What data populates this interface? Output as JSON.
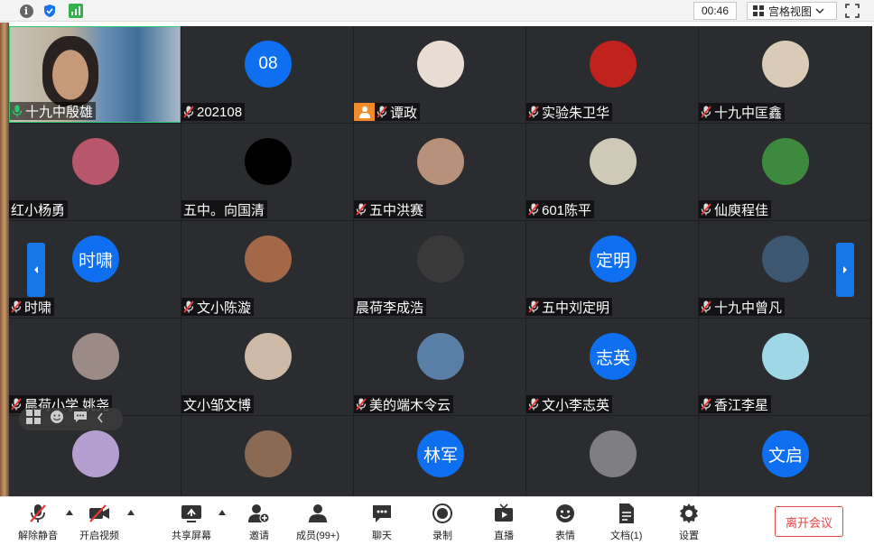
{
  "topbar": {
    "timer": "00:46",
    "view_label": "宫格视图",
    "icons": [
      "info-icon",
      "shield-icon",
      "signal-icon",
      "grid-view-icon",
      "chevron-down-icon",
      "fullscreen-icon"
    ]
  },
  "participants": [
    {
      "name": "十九中殷雄",
      "avatar_text": "",
      "avatar_color": "#7a6e62",
      "mic": "on",
      "video": true
    },
    {
      "name": "202108",
      "avatar_text": "08",
      "avatar_color": "#0e6ff0",
      "mic": "muted"
    },
    {
      "name": "谭政",
      "avatar_text": "",
      "avatar_color": "#e9dcd3",
      "mic": "muted",
      "badge": "user-icon"
    },
    {
      "name": "实验朱卫华",
      "avatar_text": "",
      "avatar_color": "#c0231d",
      "mic": "muted"
    },
    {
      "name": "十九中匡鑫",
      "avatar_text": "",
      "avatar_color": "#d9cbb6",
      "mic": "muted"
    },
    {
      "name": "红小杨勇",
      "avatar_text": "",
      "avatar_color": "#b8576c",
      "mic": "none"
    },
    {
      "name": "五中。向国清",
      "avatar_text": "",
      "avatar_color": "#000000",
      "mic": "none"
    },
    {
      "name": "五中洪赛",
      "avatar_text": "",
      "avatar_color": "#b79179",
      "mic": "muted"
    },
    {
      "name": "601陈平",
      "avatar_text": "",
      "avatar_color": "#cfc9b8",
      "mic": "muted"
    },
    {
      "name": "仙庾程佳",
      "avatar_text": "",
      "avatar_color": "#3d8a3f",
      "mic": "muted"
    },
    {
      "name": "时啸",
      "avatar_text": "时啸",
      "avatar_color": "#0e6ff0",
      "mic": "muted"
    },
    {
      "name": "文小陈漩",
      "avatar_text": "",
      "avatar_color": "#a36846",
      "mic": "muted"
    },
    {
      "name": "晨荷李成浩",
      "avatar_text": "",
      "avatar_color": "#3b3a3a",
      "mic": "none"
    },
    {
      "name": "五中刘定明",
      "avatar_text": "定明",
      "avatar_color": "#0e6ff0",
      "mic": "muted"
    },
    {
      "name": "十九中曾凡",
      "avatar_text": "",
      "avatar_color": "#3e5770",
      "mic": "muted"
    },
    {
      "name": "晨荷小学 姚尧",
      "avatar_text": "",
      "avatar_color": "#9c8a86",
      "mic": "muted"
    },
    {
      "name": "文小邹文博",
      "avatar_text": "",
      "avatar_color": "#cdb9a6",
      "mic": "none"
    },
    {
      "name": "美的端木令云",
      "avatar_text": "",
      "avatar_color": "#5a7fa6",
      "mic": "muted"
    },
    {
      "name": "文小李志英",
      "avatar_text": "志英",
      "avatar_color": "#0e6ff0",
      "mic": "muted"
    },
    {
      "name": "香江李星",
      "avatar_text": "",
      "avatar_color": "#9fd7e6",
      "mic": "muted"
    },
    {
      "name": "",
      "avatar_text": "",
      "avatar_color": "#b49fd0",
      "mic": "none"
    },
    {
      "name": "",
      "avatar_text": "",
      "avatar_color": "#8a6a52",
      "mic": "none"
    },
    {
      "name": "",
      "avatar_text": "林军",
      "avatar_color": "#0e6ff0",
      "mic": "none"
    },
    {
      "name": "",
      "avatar_text": "",
      "avatar_color": "#7f7f82",
      "mic": "none"
    },
    {
      "name": "",
      "avatar_text": "文启",
      "avatar_color": "#0e6ff0",
      "mic": "none"
    }
  ],
  "toolbar": {
    "mute": "解除静音",
    "video": "开启视频",
    "share": "共享屏幕",
    "invite": "邀请",
    "members": "成员(99+)",
    "chat": "聊天",
    "record": "录制",
    "live": "直播",
    "emoji": "表情",
    "docs": "文档(1)",
    "settings": "设置",
    "leave": "离开会议"
  }
}
